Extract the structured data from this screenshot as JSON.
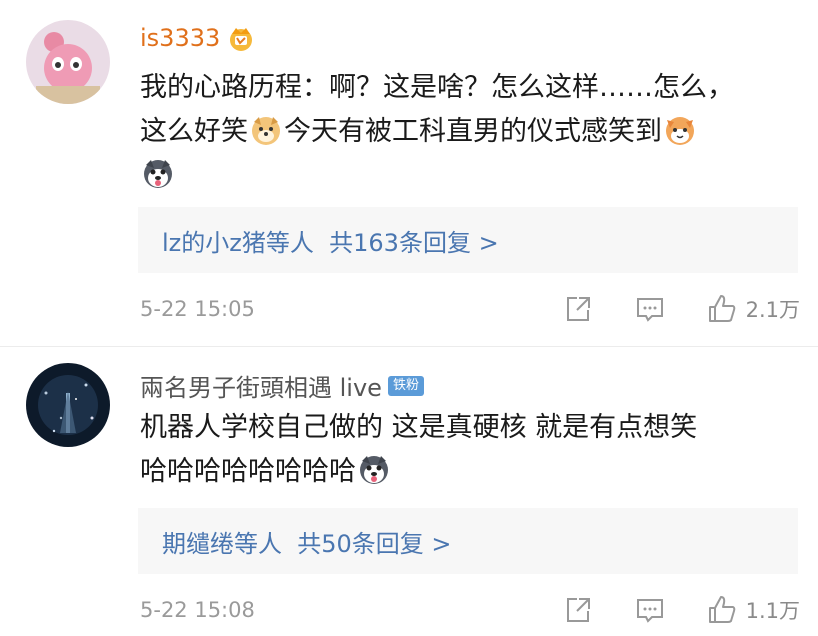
{
  "comments": [
    {
      "username": "is3333",
      "user_color": "#e0701b",
      "vip_icon": "crown-vip-icon",
      "text_lines": [
        [
          "我的心路历程：啊？这是啥？怎么这样……怎么，"
        ],
        [
          "这么好笑",
          "doge-emoji",
          "今天有被工科直男的仪式感笑到",
          "cat-emoji"
        ],
        [
          "husky-emoji"
        ]
      ],
      "reply_prefix": "lz的小z猪等人",
      "reply_count": "共163条回复 >",
      "timestamp": "5-22 15:05",
      "likes": "2.1万"
    },
    {
      "username": "兩名男子街頭相遇 live",
      "user_color": "#555555",
      "badge": "铁粉",
      "text_lines": [
        [
          "机器人学校自己做的 这是真硬核 就是有点想笑"
        ],
        [
          "哈哈哈哈哈哈哈哈",
          "husky-emoji"
        ]
      ],
      "reply_prefix": "期缱绻等人",
      "reply_count": "共50条回复 >",
      "timestamp": "5-22 15:08",
      "likes": "1.1万"
    }
  ]
}
